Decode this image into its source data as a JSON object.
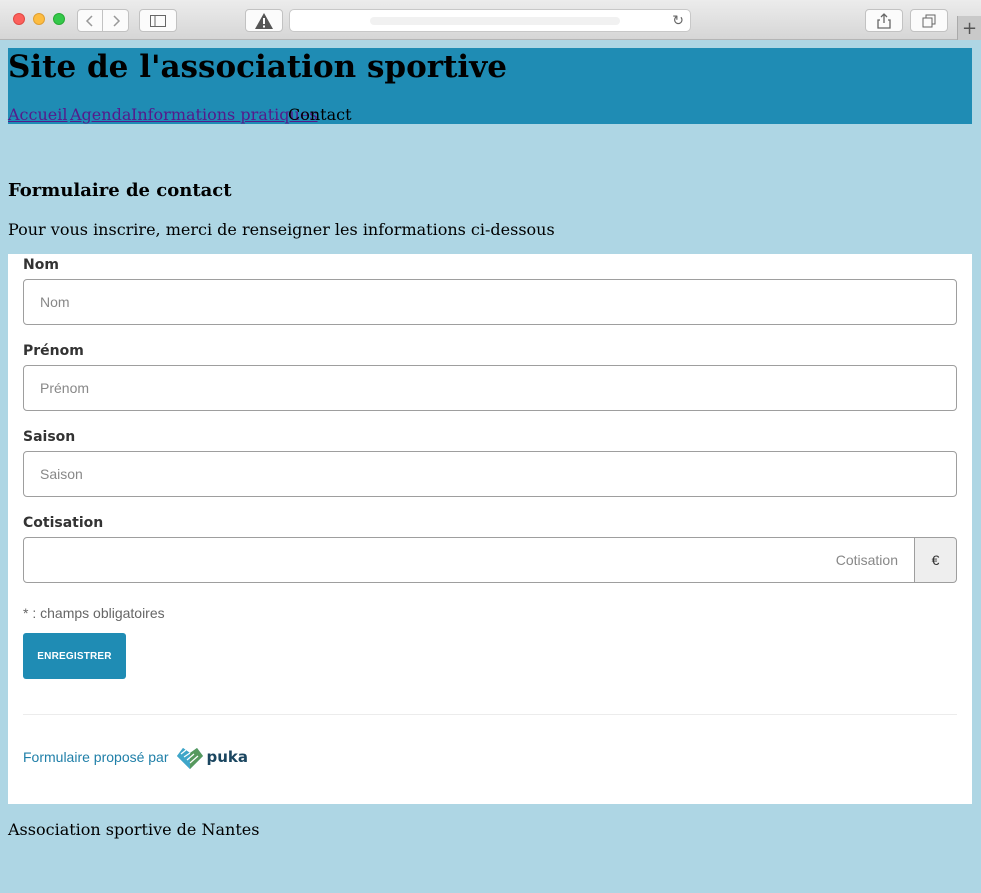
{
  "browser": {
    "warning_icon": "warning-triangle-icon"
  },
  "header": {
    "title": "Site de l'association sportive",
    "nav": [
      {
        "label": "Accueil"
      },
      {
        "label": "Agenda"
      },
      {
        "label": "Informations pratiques"
      },
      {
        "label": "Contact"
      }
    ]
  },
  "main": {
    "heading": "Formulaire de contact",
    "intro": "Pour vous inscrire, merci de renseigner les informations ci-dessous"
  },
  "form": {
    "fields": [
      {
        "label": "Nom",
        "placeholder": "Nom",
        "value": ""
      },
      {
        "label": "Prénom",
        "placeholder": "Prénom",
        "value": ""
      },
      {
        "label": "Saison",
        "placeholder": "Saison",
        "value": ""
      },
      {
        "label": "Cotisation",
        "placeholder": "Cotisation",
        "value": "",
        "addon": "€"
      }
    ],
    "required_note": "* : champs obligatoires",
    "submit_label": "ENREGISTRER",
    "powered_by": "Formulaire proposé par",
    "brand": "puka",
    "accent_color": "#1f8cb4"
  },
  "footer": {
    "text": "Association sportive de Nantes"
  }
}
